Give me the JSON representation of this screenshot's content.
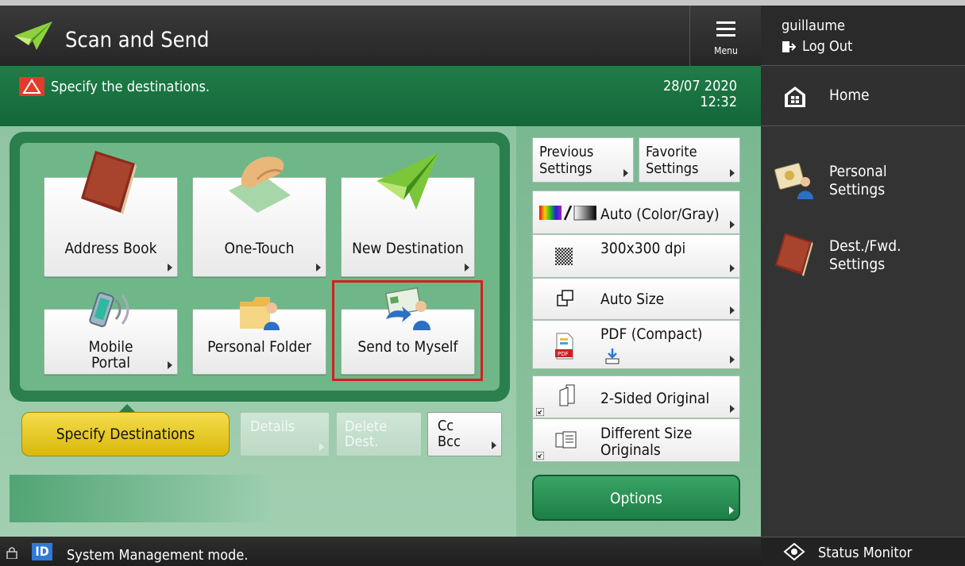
{
  "app": {
    "title": "Scan and Send"
  },
  "menu": {
    "label": "Menu"
  },
  "user": {
    "name": "guillaume",
    "logout_label": "Log Out"
  },
  "status": {
    "message": "Specify the destinations.",
    "date": "28/07 2020",
    "time": "12:32"
  },
  "sidebar": {
    "home_label": "Home",
    "items": [
      {
        "line1": "Personal",
        "line2": "Settings",
        "icon": "personal-settings-icon"
      },
      {
        "line1": "Dest./Fwd.",
        "line2": "Settings",
        "icon": "address-book-icon"
      }
    ]
  },
  "destinations": {
    "tiles": [
      {
        "label": "Address Book",
        "icon": "address-book-icon"
      },
      {
        "label": "One-Touch",
        "icon": "one-touch-icon"
      },
      {
        "label": "New Destination",
        "icon": "paper-plane-icon"
      },
      {
        "label_line1": "Mobile",
        "label_line2": "Portal",
        "icon": "mobile-icon"
      },
      {
        "label": "Personal Folder",
        "icon": "folder-icon"
      },
      {
        "label": "Send to Myself",
        "icon": "send-to-myself-icon"
      }
    ]
  },
  "actions": {
    "specify_label": "Specify Destinations",
    "details_label": "Details",
    "delete_line1": "Delete",
    "delete_line2": "Dest.",
    "cc_line1": "Cc",
    "cc_line2": "Bcc"
  },
  "settings": {
    "previous_line1": "Previous",
    "previous_line2": "Settings",
    "favorite_line1": "Favorite",
    "favorite_line2": "Settings",
    "color_mode": "Auto (Color/Gray)",
    "resolution": "300x300 dpi",
    "scan_size": "Auto Size",
    "file_format": "PDF (Compact)",
    "sided_original": "2-Sided Original",
    "different_size_line1": "Different Size",
    "different_size_line2": "Originals",
    "options_label": "Options"
  },
  "footer": {
    "mode_text": "System Management mode.",
    "id_badge": "ID",
    "status_monitor": "Status Monitor"
  },
  "colors": {
    "accent_green": "#1f7d47",
    "warning_red": "#e23b2e",
    "highlight_red": "#d41f1f",
    "specify_yellow": "#f4dc4c"
  }
}
